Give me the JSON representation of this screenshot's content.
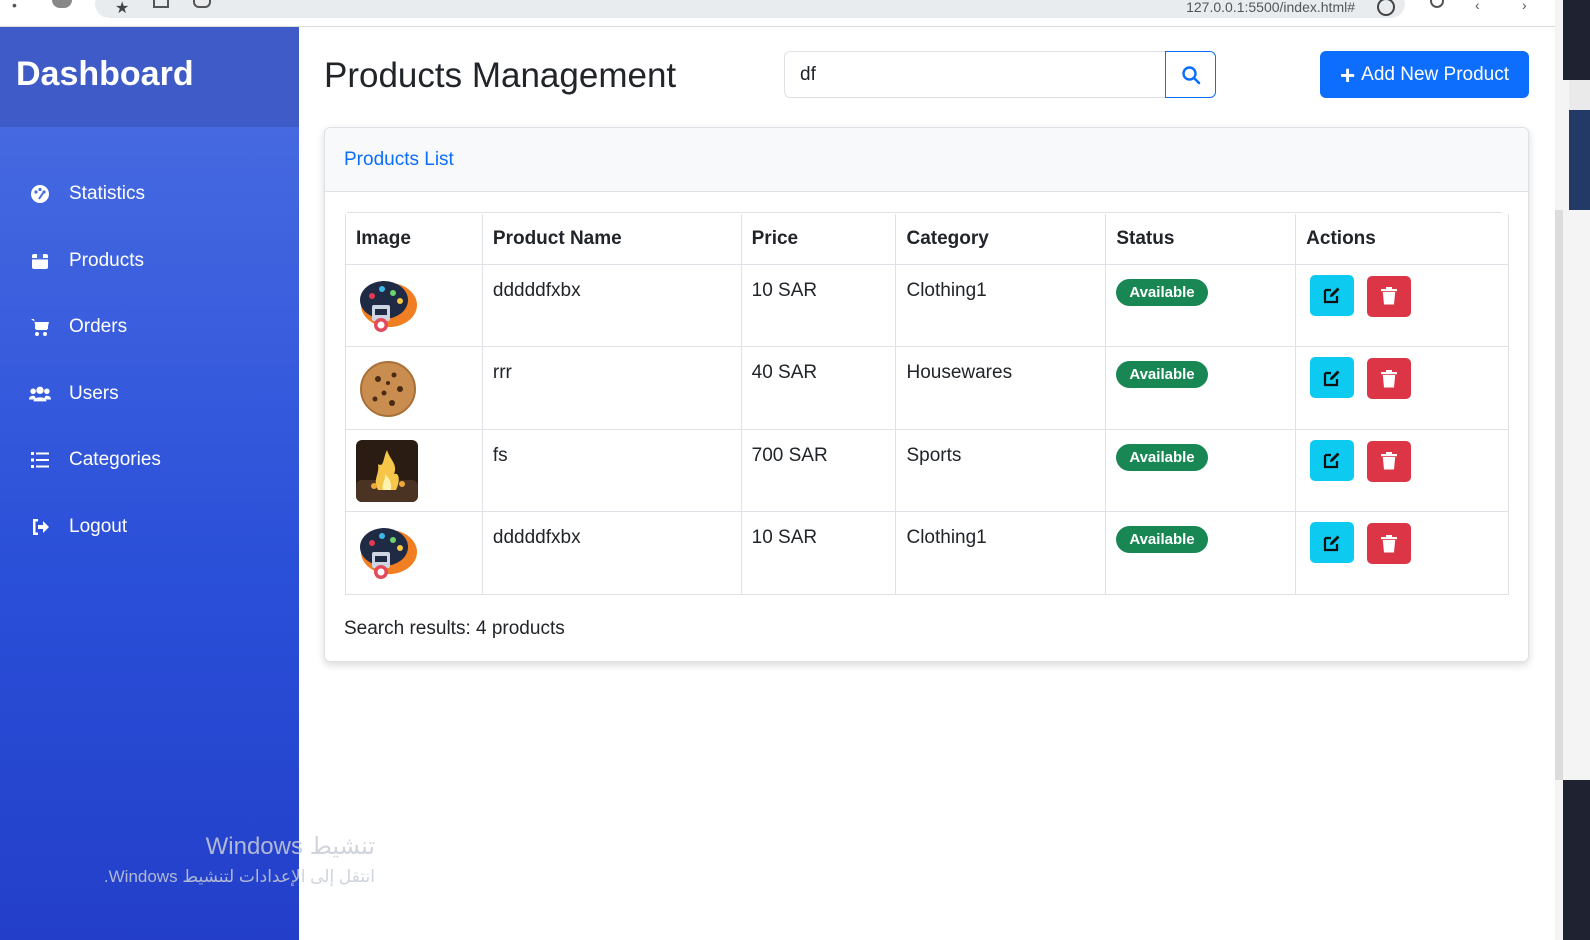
{
  "browser": {
    "url": "127.0.0.1:5500/index.html#"
  },
  "sidebar": {
    "title": "Dashboard",
    "items": [
      {
        "label": "Statistics",
        "icon": "palette-icon"
      },
      {
        "label": "Products",
        "icon": "box-icon"
      },
      {
        "label": "Orders",
        "icon": "cart-icon"
      },
      {
        "label": "Users",
        "icon": "users-icon"
      },
      {
        "label": "Categories",
        "icon": "list-icon"
      },
      {
        "label": "Logout",
        "icon": "logout-icon"
      }
    ]
  },
  "header": {
    "title": "Products Management",
    "search_value": "df",
    "add_label": "Add New Product"
  },
  "card": {
    "title": "Products List",
    "columns": [
      "Image",
      "Product Name",
      "Price",
      "Category",
      "Status",
      "Actions"
    ],
    "rows": [
      {
        "image": "robot-icon-thumbnail",
        "name": "dddddfxbx",
        "price": "10 SAR",
        "category": "Clothing1",
        "status": "Available"
      },
      {
        "image": "cookie-thumbnail",
        "name": "rrr",
        "price": "40 SAR",
        "category": "Housewares",
        "status": "Available"
      },
      {
        "image": "flame-photo-thumbnail",
        "name": "fs",
        "price": "700 SAR",
        "category": "Sports",
        "status": "Available"
      },
      {
        "image": "robot-icon-thumbnail",
        "name": "dddddfxbx",
        "price": "10 SAR",
        "category": "Clothing1",
        "status": "Available"
      }
    ],
    "results_text": "Search results: 4 products"
  },
  "watermark": {
    "line1": "تنشيط Windows",
    "line2": "انتقل إلى الإعدادات لتنشيط Windows."
  },
  "colors": {
    "primary": "#0d6efd",
    "success": "#198754",
    "info": "#0dcaf0",
    "danger": "#dc3545",
    "sidebar": "#2f55dd"
  }
}
